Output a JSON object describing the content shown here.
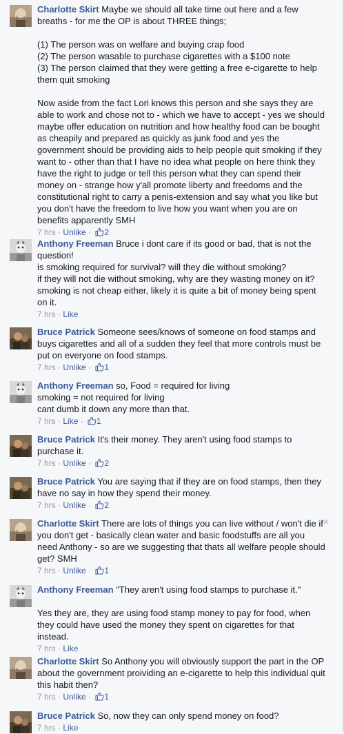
{
  "comments": [
    {
      "author": "Charlotte Skirt",
      "avatar": "charlotte-avatar",
      "paragraphs": [
        "Maybe we should all take time out here and a few breaths - for me the OP is about THREE things;",
        "(1) The person was on welfare and buying crap food\n(2) The person wasable to purchase cigarettes with a $100 note\n(3) The person claimed that they were getting a free e-cigarette to help them quit smoking",
        "Now aside from the fact Lori knows this person and she says they are able to work and chose not to - which we have to accept - yes we should maybe offer education on nutrition and how healthy food can be bought as cheapily and prepared as quickly as junk food and yes the government should be providing aids to help people quit smoking if they want to - other than that I have no idea what people on here think they have the right to judge or tell this person what they can spend their money on - strange how y'all promote liberty and freedoms and the constitutional right to carry a penis-extension and say what you like but you don't have the freedom to live how you want when you are on benefits apparently SMH"
      ],
      "time": "7 hrs",
      "action": "Unlike",
      "likes": "2"
    },
    {
      "author": "Anthony Freeman",
      "avatar": "anthony-avatar",
      "paragraphs": [
        "Bruce i dont care if its good or bad, that is not the question!\nis smoking required for survival? will they die without smoking?\nif they will not die without smoking, why are they wasting money on it? smoking is not cheap either, likely it is quite a bit of money being spent on it."
      ],
      "time": "7 hrs",
      "action": "Like",
      "likes": ""
    },
    {
      "author": "Bruce Patrick",
      "avatar": "bruce-avatar",
      "paragraphs": [
        "Someone sees/knows of someone on food stamps and buys cigarettes and all of a sudden they feel that more controls must be put on everyone on food stamps."
      ],
      "time": "7 hrs",
      "action": "Unlike",
      "likes": "1"
    },
    {
      "author": "Anthony Freeman",
      "avatar": "anthony-avatar",
      "paragraphs": [
        "so, Food = required for living\nsmoking = not required for living\ncant dumb it down any more than that."
      ],
      "time": "7 hrs",
      "action": "Like",
      "likes": "1"
    },
    {
      "author": "Bruce Patrick",
      "avatar": "bruce-avatar",
      "paragraphs": [
        "It's their money. They aren't using food stamps to purchase it."
      ],
      "time": "7 hrs",
      "action": "Unlike",
      "likes": "2"
    },
    {
      "author": "Bruce Patrick",
      "avatar": "bruce-avatar",
      "paragraphs": [
        "You are saying that if they are on food stamps, then they have no say in how they spend their money."
      ],
      "time": "7 hrs",
      "action": "Unlike",
      "likes": "2"
    },
    {
      "author": "Charlotte Skirt",
      "avatar": "charlotte-avatar",
      "paragraphs": [
        "There are lots of things you can live without / won't die if you don't get - basically clean water and basic foodstuffs are all you need Anthony - so are we suggesting that thats all welfare people should get? SMH"
      ],
      "time": "7 hrs",
      "action": "Unlike",
      "likes": "1",
      "close": "×"
    },
    {
      "author": "Anthony Freeman",
      "avatar": "anthony-avatar",
      "paragraphs": [
        "\"They aren't using food stamps to purchase it.\"",
        "Yes they are, they are using food stamp money to pay for food, when they could have used the money they spent on cigarettes for that instead."
      ],
      "time": "7 hrs",
      "action": "Like",
      "likes": ""
    },
    {
      "author": "Charlotte Skirt",
      "avatar": "charlotte-avatar",
      "paragraphs": [
        "So Anthony you will obviously support the part in the OP about the government proividing an e-cigarette to help this individual quit this habit then?"
      ],
      "time": "7 hrs",
      "action": "Unlike",
      "likes": "1"
    },
    {
      "author": "Bruce Patrick",
      "avatar": "bruce-avatar",
      "paragraphs": [
        "So, now they can only spend money on food?"
      ],
      "time": "7 hrs",
      "action": "Like",
      "likes": ""
    }
  ],
  "colors": {
    "link": "#3b5998",
    "meta": "#9197a3",
    "text": "#141823",
    "background": "#f6f7f9"
  }
}
